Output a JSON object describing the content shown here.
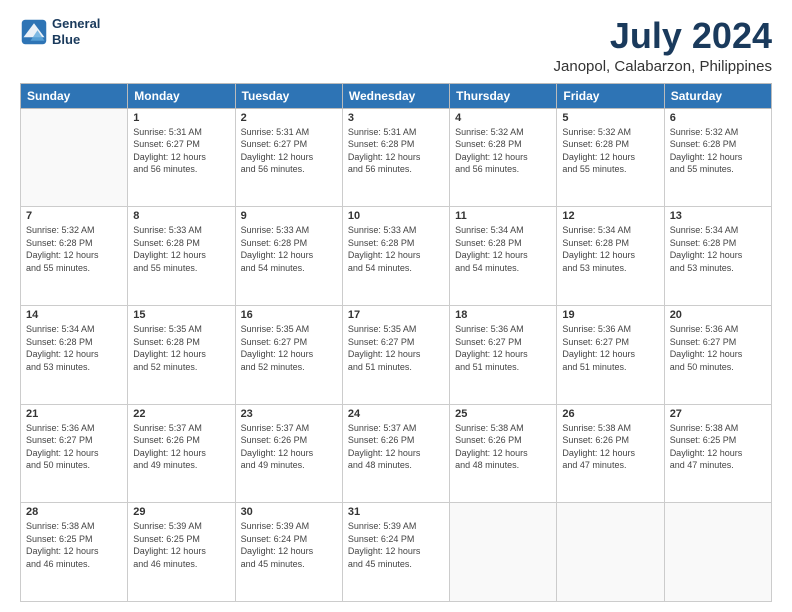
{
  "logo": {
    "line1": "General",
    "line2": "Blue"
  },
  "title": "July 2024",
  "subtitle": "Janopol, Calabarzon, Philippines",
  "headers": [
    "Sunday",
    "Monday",
    "Tuesday",
    "Wednesday",
    "Thursday",
    "Friday",
    "Saturday"
  ],
  "weeks": [
    [
      {
        "num": "",
        "info": ""
      },
      {
        "num": "1",
        "info": "Sunrise: 5:31 AM\nSunset: 6:27 PM\nDaylight: 12 hours\nand 56 minutes."
      },
      {
        "num": "2",
        "info": "Sunrise: 5:31 AM\nSunset: 6:27 PM\nDaylight: 12 hours\nand 56 minutes."
      },
      {
        "num": "3",
        "info": "Sunrise: 5:31 AM\nSunset: 6:28 PM\nDaylight: 12 hours\nand 56 minutes."
      },
      {
        "num": "4",
        "info": "Sunrise: 5:32 AM\nSunset: 6:28 PM\nDaylight: 12 hours\nand 56 minutes."
      },
      {
        "num": "5",
        "info": "Sunrise: 5:32 AM\nSunset: 6:28 PM\nDaylight: 12 hours\nand 55 minutes."
      },
      {
        "num": "6",
        "info": "Sunrise: 5:32 AM\nSunset: 6:28 PM\nDaylight: 12 hours\nand 55 minutes."
      }
    ],
    [
      {
        "num": "7",
        "info": "Sunrise: 5:32 AM\nSunset: 6:28 PM\nDaylight: 12 hours\nand 55 minutes."
      },
      {
        "num": "8",
        "info": "Sunrise: 5:33 AM\nSunset: 6:28 PM\nDaylight: 12 hours\nand 55 minutes."
      },
      {
        "num": "9",
        "info": "Sunrise: 5:33 AM\nSunset: 6:28 PM\nDaylight: 12 hours\nand 54 minutes."
      },
      {
        "num": "10",
        "info": "Sunrise: 5:33 AM\nSunset: 6:28 PM\nDaylight: 12 hours\nand 54 minutes."
      },
      {
        "num": "11",
        "info": "Sunrise: 5:34 AM\nSunset: 6:28 PM\nDaylight: 12 hours\nand 54 minutes."
      },
      {
        "num": "12",
        "info": "Sunrise: 5:34 AM\nSunset: 6:28 PM\nDaylight: 12 hours\nand 53 minutes."
      },
      {
        "num": "13",
        "info": "Sunrise: 5:34 AM\nSunset: 6:28 PM\nDaylight: 12 hours\nand 53 minutes."
      }
    ],
    [
      {
        "num": "14",
        "info": "Sunrise: 5:34 AM\nSunset: 6:28 PM\nDaylight: 12 hours\nand 53 minutes."
      },
      {
        "num": "15",
        "info": "Sunrise: 5:35 AM\nSunset: 6:28 PM\nDaylight: 12 hours\nand 52 minutes."
      },
      {
        "num": "16",
        "info": "Sunrise: 5:35 AM\nSunset: 6:27 PM\nDaylight: 12 hours\nand 52 minutes."
      },
      {
        "num": "17",
        "info": "Sunrise: 5:35 AM\nSunset: 6:27 PM\nDaylight: 12 hours\nand 51 minutes."
      },
      {
        "num": "18",
        "info": "Sunrise: 5:36 AM\nSunset: 6:27 PM\nDaylight: 12 hours\nand 51 minutes."
      },
      {
        "num": "19",
        "info": "Sunrise: 5:36 AM\nSunset: 6:27 PM\nDaylight: 12 hours\nand 51 minutes."
      },
      {
        "num": "20",
        "info": "Sunrise: 5:36 AM\nSunset: 6:27 PM\nDaylight: 12 hours\nand 50 minutes."
      }
    ],
    [
      {
        "num": "21",
        "info": "Sunrise: 5:36 AM\nSunset: 6:27 PM\nDaylight: 12 hours\nand 50 minutes."
      },
      {
        "num": "22",
        "info": "Sunrise: 5:37 AM\nSunset: 6:26 PM\nDaylight: 12 hours\nand 49 minutes."
      },
      {
        "num": "23",
        "info": "Sunrise: 5:37 AM\nSunset: 6:26 PM\nDaylight: 12 hours\nand 49 minutes."
      },
      {
        "num": "24",
        "info": "Sunrise: 5:37 AM\nSunset: 6:26 PM\nDaylight: 12 hours\nand 48 minutes."
      },
      {
        "num": "25",
        "info": "Sunrise: 5:38 AM\nSunset: 6:26 PM\nDaylight: 12 hours\nand 48 minutes."
      },
      {
        "num": "26",
        "info": "Sunrise: 5:38 AM\nSunset: 6:26 PM\nDaylight: 12 hours\nand 47 minutes."
      },
      {
        "num": "27",
        "info": "Sunrise: 5:38 AM\nSunset: 6:25 PM\nDaylight: 12 hours\nand 47 minutes."
      }
    ],
    [
      {
        "num": "28",
        "info": "Sunrise: 5:38 AM\nSunset: 6:25 PM\nDaylight: 12 hours\nand 46 minutes."
      },
      {
        "num": "29",
        "info": "Sunrise: 5:39 AM\nSunset: 6:25 PM\nDaylight: 12 hours\nand 46 minutes."
      },
      {
        "num": "30",
        "info": "Sunrise: 5:39 AM\nSunset: 6:24 PM\nDaylight: 12 hours\nand 45 minutes."
      },
      {
        "num": "31",
        "info": "Sunrise: 5:39 AM\nSunset: 6:24 PM\nDaylight: 12 hours\nand 45 minutes."
      },
      {
        "num": "",
        "info": ""
      },
      {
        "num": "",
        "info": ""
      },
      {
        "num": "",
        "info": ""
      }
    ]
  ]
}
